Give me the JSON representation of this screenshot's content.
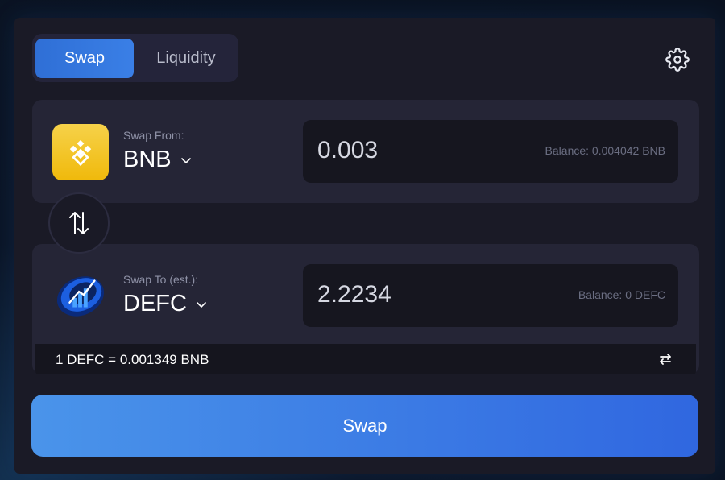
{
  "tabs": {
    "swap_label": "Swap",
    "liquidity_label": "Liquidity"
  },
  "settings": {
    "icon": "gear-icon"
  },
  "from": {
    "label": "Swap From:",
    "token": "BNB",
    "token_icon": "bnb-logo-icon",
    "amount": "0.003",
    "balance": "Balance: 0.004042 BNB"
  },
  "switch": {
    "icon": "swap-vertical-arrows-icon"
  },
  "to": {
    "label": "Swap To (est.):",
    "token": "DEFC",
    "token_icon": "defc-logo-icon",
    "amount": "2.2234",
    "balance": "Balance: 0 DEFC"
  },
  "rate": {
    "text": "1 DEFC = 0.001349 BNB",
    "toggle_icon": "swap-horizontal-arrows-icon"
  },
  "submit": {
    "label": "Swap"
  },
  "colors": {
    "accent": "#3a7fe6",
    "card": "#1a1a26",
    "panel": "#252536",
    "bnb_yellow": "#f0b90b"
  }
}
